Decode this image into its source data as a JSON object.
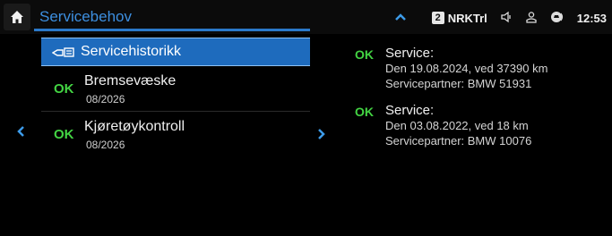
{
  "header": {
    "title": "Servicebehov",
    "badge": "2",
    "radio_station": "NRKTrl",
    "clock": "12:53"
  },
  "icons": {
    "home": "home-icon",
    "up": "chevron-up-icon",
    "speaker": "speaker-icon",
    "user": "user-profile-icon",
    "connectivity": "connected-car-icon",
    "history": "service-history-icon",
    "left": "chevron-left-icon",
    "right": "chevron-right-icon"
  },
  "list": {
    "history_label": "Servicehistorikk",
    "items": [
      {
        "status": "OK",
        "name": "Bremsevæske",
        "date": "08/2026"
      },
      {
        "status": "OK",
        "name": "Kjøretøykontroll",
        "date": "08/2026"
      }
    ]
  },
  "details": {
    "entries": [
      {
        "status": "OK",
        "label": "Service:",
        "line1": "Den 19.08.2024, ved 37390 km",
        "line2": "Servicepartner: BMW 51931"
      },
      {
        "status": "OK",
        "label": "Service:",
        "line1": "Den 03.08.2022, ved 18 km",
        "line2": "Servicepartner: BMW 10076"
      }
    ]
  },
  "colors": {
    "accent": "#3d8fe0",
    "selected_row": "#1e6bbd",
    "ok_green": "#43d443"
  }
}
